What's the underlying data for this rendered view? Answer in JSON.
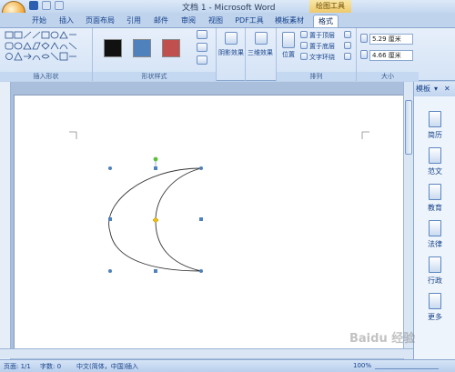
{
  "titlebar": {
    "title": "文档 1 - Microsoft Word",
    "context_tab": "绘图工具"
  },
  "tabs": [
    "开始",
    "插入",
    "页面布局",
    "引用",
    "邮件",
    "审阅",
    "视图",
    "PDF工具",
    "模板素材",
    "格式"
  ],
  "ribbon": {
    "groups": [
      "插入形状",
      "形状样式",
      "阴影效果",
      "三维效果",
      "排列",
      "大小"
    ],
    "shadow_label": "阴影效果",
    "threed_label": "三维效果",
    "position_label": "位置",
    "bring_front": "置于顶层",
    "send_back": "置于底层",
    "text_wrap": "文字环绕",
    "height_value": "5.29 厘米",
    "width_value": "4.66 厘米"
  },
  "pane": {
    "title": "模板",
    "items": [
      "简历",
      "范文",
      "教育",
      "法律",
      "行政",
      "更多"
    ]
  },
  "status": {
    "page": "页面: 1/1",
    "words": "字数: 0",
    "language": "中文(简体，中国)",
    "mode": "插入",
    "zoom": "100%"
  },
  "watermark": "Baidu 经验"
}
